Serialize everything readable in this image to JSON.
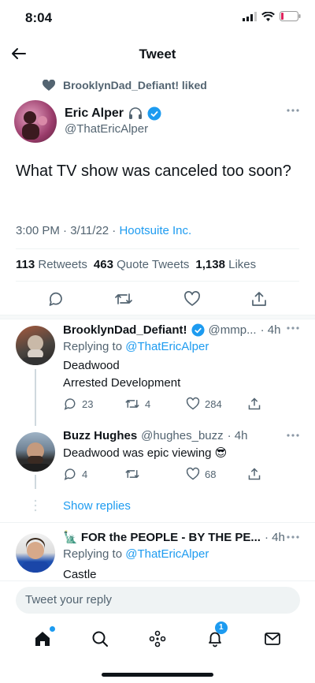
{
  "status_bar": {
    "time": "8:04"
  },
  "header": {
    "title": "Tweet"
  },
  "context": {
    "liked_by": "BrooklynDad_Defiant! liked"
  },
  "tweet": {
    "author_name": "Eric Alper",
    "author_handle": "@ThatEricAlper",
    "text": "What TV show was canceled too soon?",
    "time": "3:00 PM · 3/11/22 · ",
    "source": "Hootsuite Inc.",
    "retweets_count": "113",
    "retweets_label": "Retweets",
    "quotes_count": "463",
    "quotes_label": "Quote Tweets",
    "likes_count": "1,138",
    "likes_label": "Likes"
  },
  "replies": [
    {
      "name": "BrooklynDad_Defiant!",
      "handle": "@mmp...",
      "time": "· 4h",
      "replying_prefix": "Replying to ",
      "replying_to": "@ThatEricAlper",
      "lines": [
        "Deadwood",
        "Arrested Development"
      ],
      "reply_count": "23",
      "retweet_count": "4",
      "like_count": "284"
    },
    {
      "name": "Buzz Hughes",
      "handle": "@hughes_buzz",
      "time": "· 4h",
      "text": "Deadwood was epic viewing 😎",
      "reply_count": "4",
      "retweet_count": "",
      "like_count": "68"
    },
    {
      "name": "🗽 FOR the PEOPLE - BY THE PE...",
      "time": "· 4h",
      "replying_prefix": "Replying to ",
      "replying_to": "@ThatEricAlper",
      "text": "Castle"
    }
  ],
  "show_replies": "Show replies",
  "reply_input": {
    "placeholder": "Tweet your reply"
  },
  "tabbar": {
    "notifications_badge": "1"
  },
  "colors": {
    "accent": "#1d9bf0",
    "text": "#0f1419",
    "muted": "#536471"
  }
}
